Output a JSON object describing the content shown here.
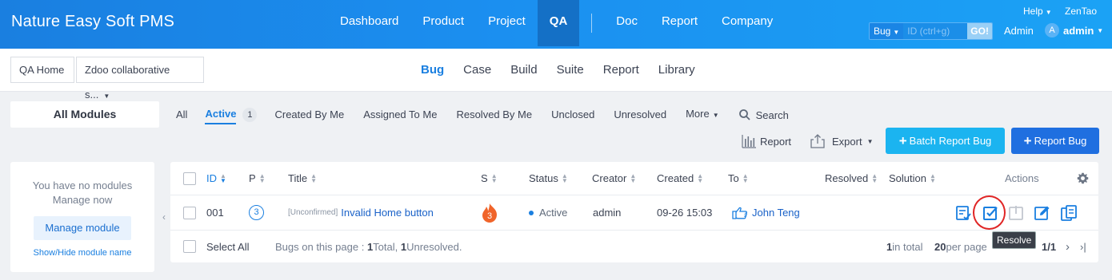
{
  "app": {
    "title": "Nature Easy Soft PMS"
  },
  "main_nav": [
    "Dashboard",
    "Product",
    "Project",
    "QA",
    "Doc",
    "Report",
    "Company"
  ],
  "main_nav_active": "QA",
  "header": {
    "help": "Help",
    "zentao": "ZenTao",
    "search_type": "Bug",
    "search_placeholder": "ID (ctrl+g)",
    "search_go": "GO!",
    "admin_link": "Admin",
    "avatar_letter": "A",
    "user": "admin"
  },
  "breadcrumb": {
    "home": "QA Home",
    "product": "Zdoo collaborative s..."
  },
  "sub_nav": [
    "Bug",
    "Case",
    "Build",
    "Suite",
    "Report",
    "Library"
  ],
  "sub_nav_active": "Bug",
  "sidebar": {
    "all_modules": "All Modules",
    "no_modules_line1": "You have no modules",
    "no_modules_line2": "Manage now",
    "manage_button": "Manage module",
    "show_hide": "Show/Hide module name"
  },
  "filters": {
    "all": "All",
    "active": "Active",
    "active_count": "1",
    "created_by_me": "Created By Me",
    "assigned_to_me": "Assigned To Me",
    "resolved_by_me": "Resolved By Me",
    "unclosed": "Unclosed",
    "unresolved": "Unresolved",
    "more": "More",
    "search": "Search"
  },
  "actions": {
    "report": "Report",
    "export": "Export",
    "batch_report": "Batch Report Bug",
    "report_bug": "Report Bug"
  },
  "table": {
    "headers": {
      "id": "ID",
      "p": "P",
      "title": "Title",
      "s": "S",
      "status": "Status",
      "creator": "Creator",
      "created": "Created",
      "to": "To",
      "resolved": "Resolved",
      "solution": "Solution",
      "actions": "Actions"
    },
    "rows": [
      {
        "id": "001",
        "priority": "3",
        "tag": "[Unconfirmed]",
        "title": "Invalid Home button",
        "severity": "3",
        "status": "Active",
        "creator": "admin",
        "created": "09-26 15:03",
        "to": "John Teng",
        "resolved": "",
        "solution": ""
      }
    ],
    "footer": {
      "select_all": "Select All",
      "summary_prefix": "Bugs on this page : ",
      "total": "1",
      "total_label": " Total, ",
      "unresolved": "1",
      "unresolved_label": " Unresolved.",
      "in_total_num": "1",
      "in_total_label": " in total",
      "per_page_num": "20",
      "per_page_label": " per page",
      "page": "1/1"
    }
  },
  "tooltip": "Resolve",
  "colors": {
    "header_start": "#1a7fe0",
    "header_end": "#1ba2f5",
    "accent": "#1a7fe0",
    "severity": "#f0642a",
    "highlight": "#e02525"
  }
}
